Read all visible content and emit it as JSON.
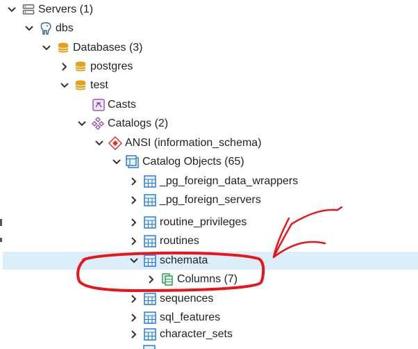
{
  "tree": {
    "servers": {
      "label": "Servers (1)",
      "icon": "server-group-icon"
    },
    "server": {
      "label": "dbs",
      "icon": "postgres-elephant-icon"
    },
    "databases": {
      "label": "Databases (3)",
      "icon": "databases-icon"
    },
    "db_postgres": {
      "label": "postgres",
      "icon": "database-icon"
    },
    "db_test": {
      "label": "test",
      "icon": "database-icon"
    },
    "casts": {
      "label": "Casts",
      "icon": "casts-icon"
    },
    "catalogs": {
      "label": "Catalogs (2)",
      "icon": "catalogs-icon"
    },
    "ansi": {
      "label": "ANSI (information_schema)",
      "icon": "catalog-icon"
    },
    "catalog_objects": {
      "label": "Catalog Objects (65)",
      "icon": "catalog-objects-icon"
    },
    "items": [
      {
        "label": "_pg_foreign_data_wrappers",
        "icon": "table-icon"
      },
      {
        "label": "_pg_foreign_servers",
        "icon": "table-icon"
      },
      {
        "label": "routine_privileges",
        "icon": "table-icon"
      },
      {
        "label": "routines",
        "icon": "table-icon"
      },
      {
        "label": "schemata",
        "icon": "table-icon",
        "selected": true
      },
      {
        "label": "Columns (7)",
        "icon": "columns-icon"
      },
      {
        "label": "sequences",
        "icon": "table-icon"
      },
      {
        "label": "sql_features",
        "icon": "table-icon"
      },
      {
        "label": "character_sets",
        "icon": "table-icon"
      }
    ]
  },
  "colors": {
    "selection": "#dbeefa",
    "annotation": "#e8161b",
    "chevron": "#333333",
    "table_icon": "#2b7cd3",
    "db_icon": "#e2a21a",
    "catalog_icon": "#9b59b6",
    "ansi_icon": "#d9342b",
    "columns_icon": "#2e9e5b"
  }
}
